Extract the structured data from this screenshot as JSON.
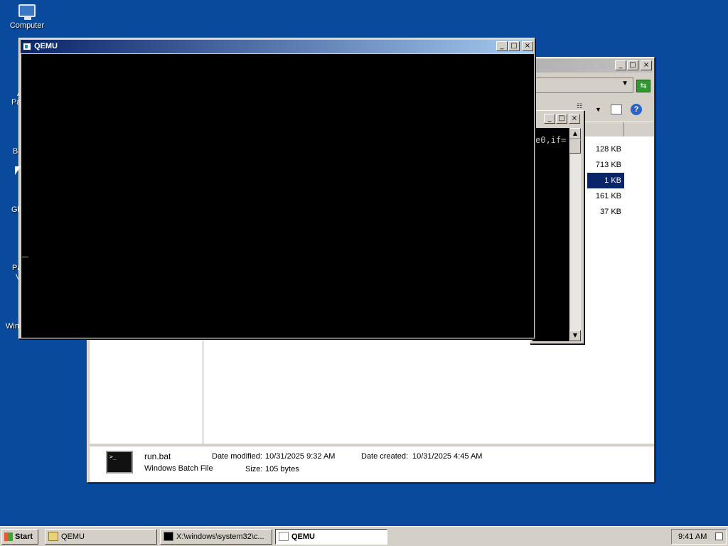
{
  "desktop": {
    "icons": [
      {
        "label": "Computer"
      },
      {
        "label": "A"
      },
      {
        "label": "Pa"
      },
      {
        "label": "Bc"
      },
      {
        "label": "Gl"
      },
      {
        "label": "Pa"
      },
      {
        "label": "V"
      },
      {
        "label": "Win"
      }
    ]
  },
  "qemu_window": {
    "title": "QEMU",
    "min": "_",
    "max": "□",
    "close": "×"
  },
  "cmd_window": {
    "visible_text": "e0,if="
  },
  "explorer": {
    "sizes": [
      "128 KB",
      "713 KB",
      "1 KB",
      "161 KB",
      "37 KB"
    ],
    "selected_index": 2,
    "details": {
      "file_name": "run.bat",
      "file_type": "Windows Batch File",
      "date_modified_label": "Date modified:",
      "date_modified_value": "10/31/2025 9:32 AM",
      "date_created_label": "Date created:",
      "date_created_value": "10/31/2025 4:45 AM",
      "size_label": "Size:",
      "size_value": "105 bytes"
    }
  },
  "taskbar": {
    "start_label": "Start",
    "tasks": [
      {
        "label": "QEMU",
        "icon": "folder-icon"
      },
      {
        "label": "X:\\windows\\system32\\c...",
        "icon": "cmd-icon"
      },
      {
        "label": "QEMU",
        "icon": "qemu-icon"
      }
    ],
    "clock": "9:41 AM"
  },
  "colors": {
    "desktop": "#0a4a9c",
    "title_active": "#0a246a",
    "selection": "#0a246a"
  }
}
